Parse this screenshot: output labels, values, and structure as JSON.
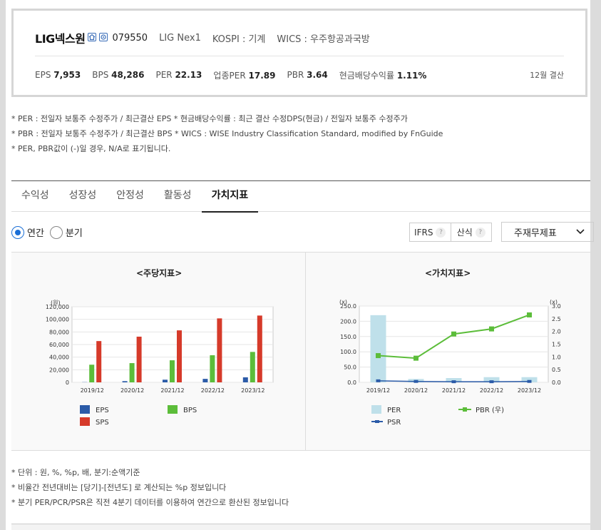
{
  "company": {
    "name": "LIG넥스원",
    "code": "079550",
    "english_name": "LIG Nex1",
    "market": "KOSPI : 기계",
    "wics": "WICS : 우주항공과국방"
  },
  "metrics": [
    {
      "label": "EPS",
      "value": "7,953"
    },
    {
      "label": "BPS",
      "value": "48,286"
    },
    {
      "label": "PER",
      "value": "22.13"
    },
    {
      "label": "업종PER",
      "value": "17.89"
    },
    {
      "label": "PBR",
      "value": "3.64"
    },
    {
      "label": "현금배당수익률",
      "value": "1.11%"
    }
  ],
  "settlement": "12월 결산",
  "notes": [
    "* PER : 전일자 보통주 수정주가 / 최근결산 EPS * 현금배당수익률 : 최근 결산 수정DPS(현금) / 전일자 보통주 수정주가",
    "* PBR : 전일자 보통주 수정주가 / 최근결산 BPS * WICS : WISE Industry Classification Standard, modified by FnGuide",
    "* PER, PBR값이 (-)일 경우, N/A로 표기됩니다."
  ],
  "tabs": [
    "수익성",
    "성장성",
    "안정성",
    "활동성",
    "가치지표"
  ],
  "active_tab": "가치지표",
  "period": {
    "annual": "연간",
    "quarter": "분기"
  },
  "buttons": {
    "ifrs": "IFRS",
    "calc": "산식",
    "q": "?"
  },
  "select": {
    "value": "주재무제표"
  },
  "colors": {
    "eps": "#2b5ba8",
    "bps": "#5cbd3a",
    "sps": "#d63a2a",
    "per": "#bfe0ea",
    "pbr": "#5cbd3a",
    "psr": "#2b5ba8"
  },
  "chart_data": [
    {
      "type": "bar",
      "title": "<주당지표>",
      "unit_label": "(원)",
      "categories": [
        "2019/12",
        "2020/12",
        "2021/12",
        "2022/12",
        "2023/12"
      ],
      "ylim": [
        0,
        120000
      ],
      "yticks": [
        "0",
        "20,000",
        "40,000",
        "60,000",
        "80,000",
        "100,000",
        "120,000"
      ],
      "series": [
        {
          "name": "EPS",
          "values": [
            300,
            1900,
            4200,
            5500,
            7953
          ]
        },
        {
          "name": "BPS",
          "values": [
            28000,
            30500,
            35000,
            43000,
            48286
          ]
        },
        {
          "name": "SPS",
          "values": [
            65500,
            72500,
            82500,
            101500,
            106000
          ]
        }
      ],
      "grid": true,
      "legend": "bottom"
    },
    {
      "type": "bar+line",
      "title": "<가치지표>",
      "left_unit": "(x)",
      "right_unit": "(x)",
      "categories": [
        "2019/12",
        "2020/12",
        "2021/12",
        "2022/12",
        "2023/12"
      ],
      "ylim_left": [
        0,
        250
      ],
      "yticks_left": [
        "0.0",
        "50.0",
        "100.0",
        "150.0",
        "200.0",
        "250.0"
      ],
      "ylim_right": [
        0,
        3.0
      ],
      "yticks_right": [
        "0.0",
        "0.5",
        "1.0",
        "1.5",
        "2.0",
        "2.5",
        "3.0"
      ],
      "series": [
        {
          "name": "PER",
          "axis": "left",
          "kind": "bar",
          "values": [
            220,
            11,
            14,
            17,
            17
          ]
        },
        {
          "name": "PBR (우)",
          "axis": "right",
          "kind": "line",
          "values": [
            1.05,
            0.95,
            1.9,
            2.1,
            2.65
          ]
        },
        {
          "name": "PSR",
          "axis": "left",
          "kind": "line",
          "values": [
            5,
            3,
            2,
            2,
            3
          ]
        }
      ],
      "grid": true,
      "legend": "bottom"
    }
  ],
  "footnotes": [
    "* 단위 : 원, %, %p, 배, 분기:순액기준",
    "* 비율간 전년대비는 [당기]-[전년도] 로 계산되는 %p 정보입니다",
    "* 분기 PER/PCR/PSR은 직전 4분기 데이터를 이용하여 연간으로 환산된 정보입니다"
  ]
}
